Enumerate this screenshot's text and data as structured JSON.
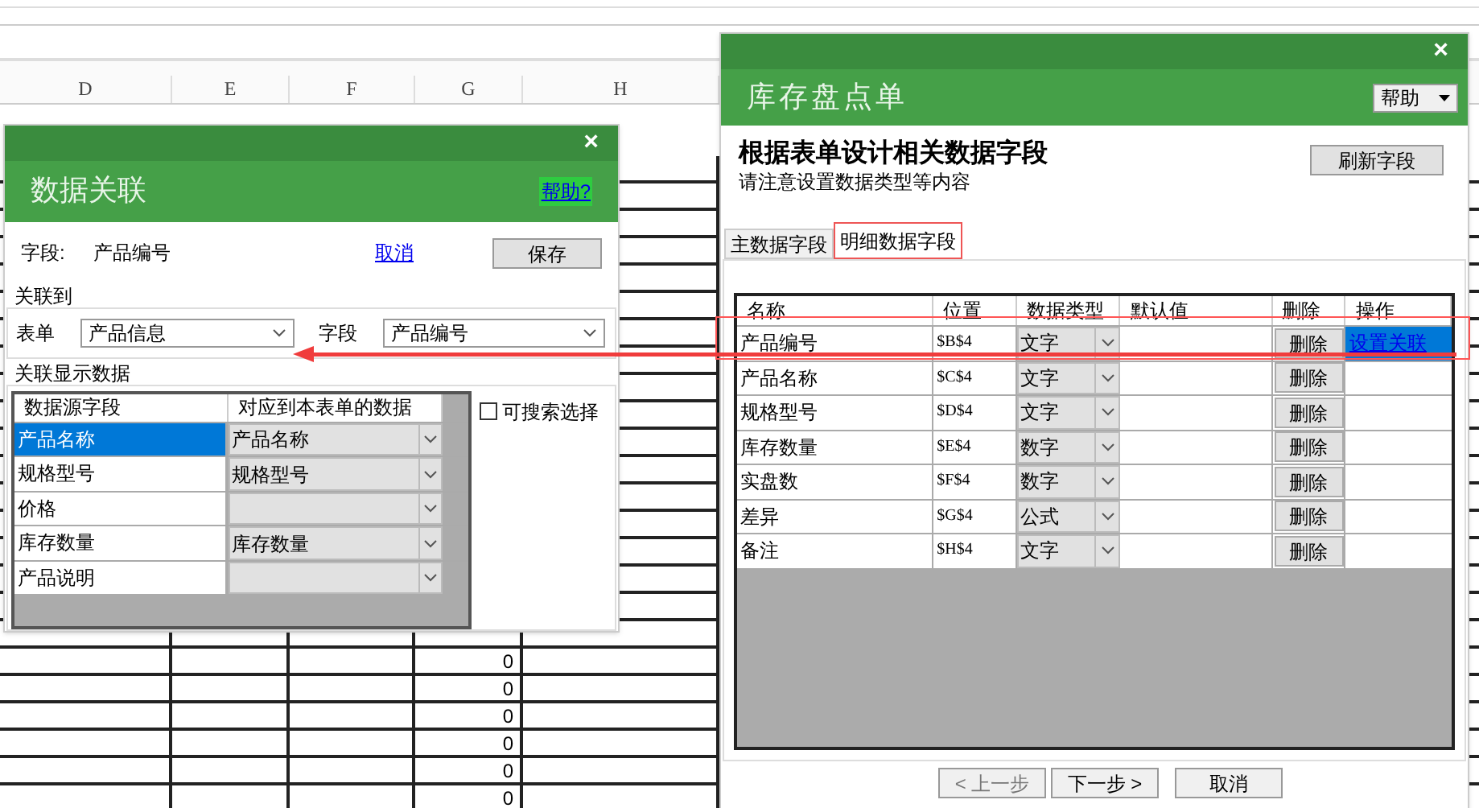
{
  "spreadsheet": {
    "columns": [
      "D",
      "E",
      "F",
      "G",
      "H"
    ],
    "column_g_values": [
      "0",
      "0",
      "0",
      "0",
      "0",
      "0"
    ]
  },
  "link_dialog": {
    "title": "数据关联",
    "close": "×",
    "help_link": "帮助?",
    "field_label": "字段:",
    "field_value": "产品编号",
    "cancel_link": "取消",
    "save_button": "保存",
    "link_to": {
      "legend": "关联到",
      "form_label": "表单",
      "form_value": "产品信息",
      "field_label": "字段",
      "field_value": "产品编号"
    },
    "display": {
      "legend": "关联显示数据",
      "columns": [
        "数据源字段",
        "对应到本表单的数据"
      ],
      "rows": [
        {
          "source": "产品名称",
          "target": "产品名称",
          "selected": true
        },
        {
          "source": "规格型号",
          "target": "规格型号",
          "selected": false
        },
        {
          "source": "价格",
          "selected": false
        },
        {
          "source": "库存数量",
          "target": "库存数量",
          "selected": false
        },
        {
          "source": "产品说明",
          "selected": false
        }
      ],
      "searchable": {
        "label": "可搜索选择",
        "checked": false
      }
    }
  },
  "inventory_dialog": {
    "title": "库存盘点单",
    "close": "×",
    "help_button": "帮助",
    "heading": "根据表单设计相关数据字段",
    "subheading": "请注意设置数据类型等内容",
    "refresh_button": "刷新字段",
    "tabs": [
      {
        "label": "主数据字段",
        "selected": false
      },
      {
        "label": "明细数据字段",
        "selected": true
      }
    ],
    "table": {
      "columns": [
        "名称",
        "位置",
        "数据类型",
        "默认值",
        "删除",
        "操作"
      ],
      "rows": [
        {
          "name": "产品编号",
          "position": "$B$4",
          "type": "文字",
          "delete_button": "删除",
          "action": "设置关联",
          "selected": true
        },
        {
          "name": "产品名称",
          "position": "$C$4",
          "type": "文字",
          "delete_button": "删除",
          "selected": false
        },
        {
          "name": "规格型号",
          "position": "$D$4",
          "type": "文字",
          "delete_button": "删除",
          "selected": false
        },
        {
          "name": "库存数量",
          "position": "$E$4",
          "type": "数字",
          "delete_button": "删除",
          "selected": false
        },
        {
          "name": "实盘数",
          "position": "$F$4",
          "type": "数字",
          "delete_button": "删除",
          "selected": false
        },
        {
          "name": "差异",
          "position": "$G$4",
          "type": "公式",
          "delete_button": "删除",
          "selected": false
        },
        {
          "name": "备注",
          "position": "$H$4",
          "type": "文字",
          "delete_button": "删除",
          "selected": false
        }
      ]
    },
    "buttons": [
      "< 上一步",
      "下一步 >",
      "取消"
    ]
  }
}
